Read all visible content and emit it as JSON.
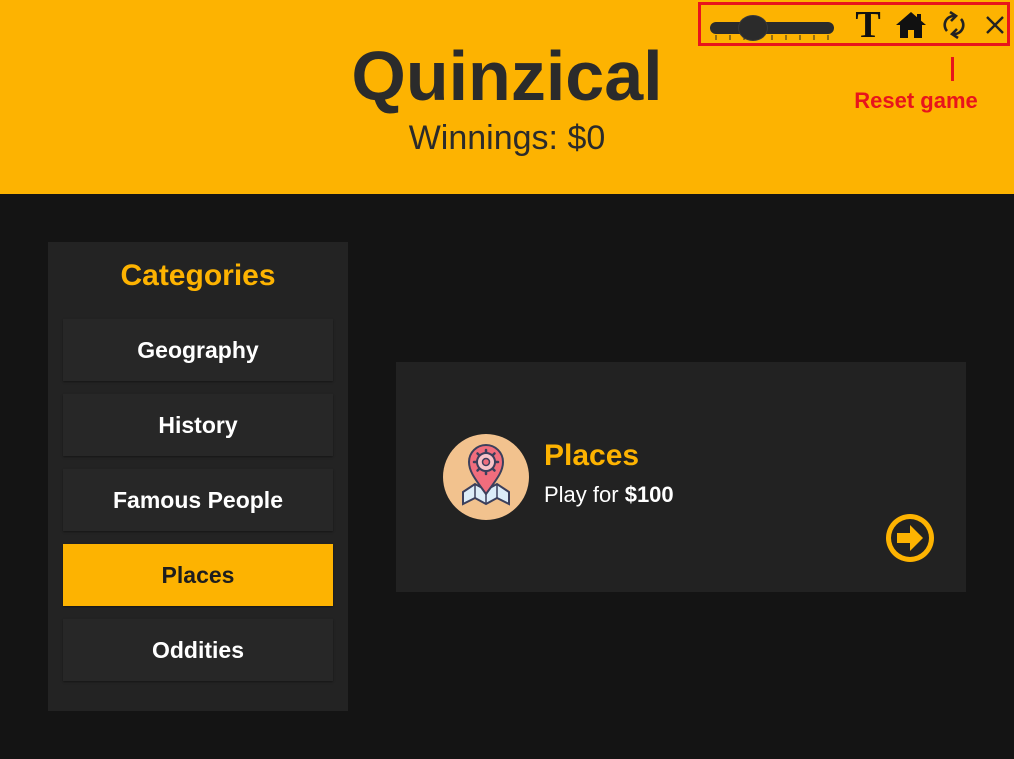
{
  "header": {
    "title": "Quinzical",
    "winnings_label": "Winnings: $0"
  },
  "toolbar": {
    "text_size_glyph": "T",
    "home_icon": "home-icon",
    "reset_icon": "refresh-icon",
    "close_icon": "close-icon",
    "font_slider_level": 0.3
  },
  "annotation": {
    "label": "Reset game",
    "color": "#e8141c"
  },
  "sidebar": {
    "title": "Categories",
    "items": [
      {
        "label": "Geography",
        "active": false
      },
      {
        "label": "History",
        "active": false
      },
      {
        "label": "Famous People",
        "active": false
      },
      {
        "label": "Places",
        "active": true
      },
      {
        "label": "Oddities",
        "active": false
      }
    ]
  },
  "card": {
    "title": "Places",
    "play_prefix": "Play for ",
    "amount": "$100",
    "icon": "map-pin-gear-icon",
    "action_icon": "arrow-right-circle-icon"
  },
  "colors": {
    "accent": "#fdb301",
    "background": "#141414",
    "panel": "#232323",
    "text_dark": "#2b2b2b"
  }
}
